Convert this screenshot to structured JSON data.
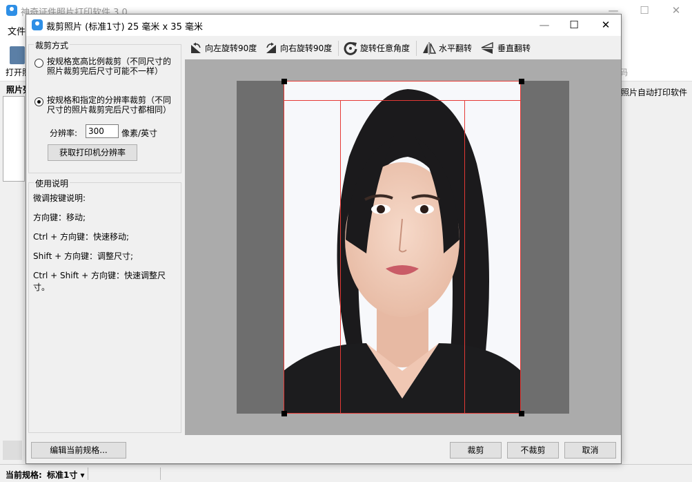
{
  "main": {
    "title": "神奇证件照片打印软件 3.0",
    "menu_file": "文件",
    "open_label": "打开照",
    "right_partial_text": "码",
    "panel_title": "照片列",
    "right_tab_text": "照片自动打印软件",
    "status_label": "当前规格:",
    "status_value": "标准1寸 ▾"
  },
  "dialog": {
    "title": "裁剪照片 (标准1寸) 25 毫米 x 35 毫米",
    "crop_mode": {
      "group_title": "裁剪方式",
      "option1_line1": "按规格宽高比例裁剪（不同尺寸的",
      "option1_line2": "照片裁剪完后尺寸可能不一样）",
      "option2_line1": "按规格和指定的分辨率裁剪（不同",
      "option2_line2": "尺寸的照片裁剪完后尺寸都相同）",
      "selected": "option2",
      "resolution_label": "分辨率:",
      "resolution_value": "300",
      "resolution_unit": "像素/英寸",
      "get_printer_dpi_button": "获取打印机分辨率"
    },
    "help": {
      "group_title": "使用说明",
      "lines": [
        "微调按键说明:",
        "方向键：移动;",
        "Ctrl + 方向键：快速移动;",
        "Shift + 方向键：调整尺寸;",
        "Ctrl + Shift + 方向键：快速调整尺寸。"
      ]
    },
    "toolbar": {
      "rotate_left": "向左旋转90度",
      "rotate_right": "向右旋转90度",
      "rotate_any": "旋转任意角度",
      "flip_h": "水平翻转",
      "flip_v": "垂直翻转"
    },
    "buttons": {
      "edit_spec": "编辑当前规格...",
      "crop": "裁剪",
      "no_crop": "不裁剪",
      "cancel": "取消"
    }
  },
  "colors": {
    "crop_frame": "#e53935",
    "canvas_bg": "#ababab",
    "app_icon": "#2e8fe6"
  }
}
